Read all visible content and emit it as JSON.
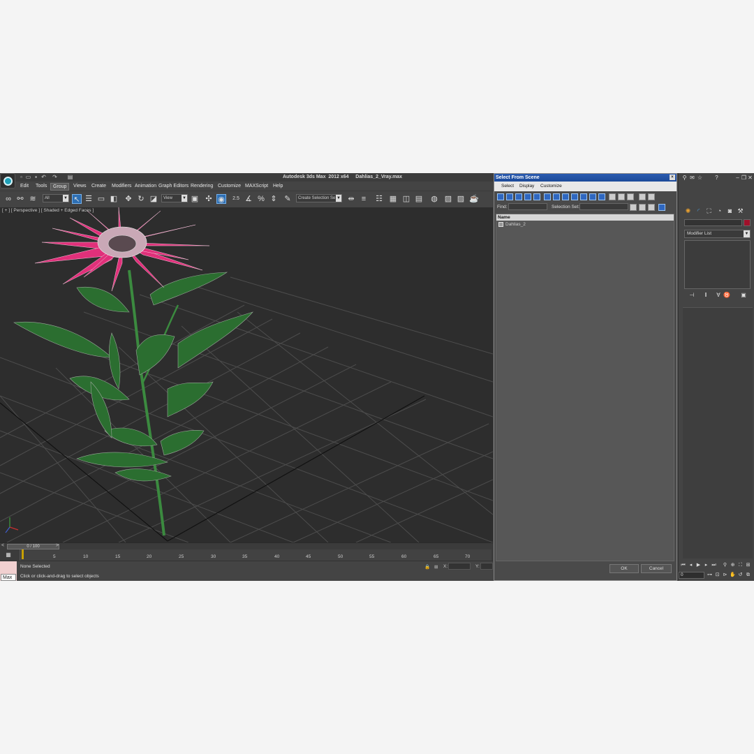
{
  "window": {
    "title": "Autodesk 3ds Max  2012 x64     Dahlias_2_Vray.max"
  },
  "menu": {
    "items": [
      "Edit",
      "Tools",
      "Group",
      "Views",
      "Create",
      "Modifiers",
      "Animation",
      "Graph Editors",
      "Rendering",
      "Customize",
      "MAXScript",
      "Help"
    ],
    "active_index": 2
  },
  "toolbar": {
    "filter_value": "All",
    "refcoord_value": "View",
    "selection_set_placeholder": "Create Selection Se",
    "snap_label": "2.5"
  },
  "viewport": {
    "label": "[ + ] [ Perspective ] [ Shaded + Edged Faces ]"
  },
  "timeline": {
    "frame_readout": "0 / 100",
    "ticks": [
      "5",
      "10",
      "15",
      "20",
      "25",
      "30",
      "35",
      "40",
      "45",
      "50",
      "55",
      "60",
      "65",
      "70"
    ]
  },
  "status": {
    "selection": "None Selected",
    "prompt": "Click or click-and-drag to select objects",
    "x_label": "X:",
    "y_label": "Y:",
    "max_label": "Max"
  },
  "dialog": {
    "title": "Select From Scene",
    "menu": [
      "Select",
      "Display",
      "Customize"
    ],
    "find_label": "Find:",
    "selection_set_label": "Selection Set:",
    "column_name": "Name",
    "objects": [
      "Dahlias_2"
    ],
    "ok_label": "OK",
    "cancel_label": "Cancel",
    "close_glyph": "×"
  },
  "command_panel": {
    "modifier_list": "Modifier List",
    "object_color": "#a0102a",
    "frame_value": "0"
  },
  "colors": {
    "accent": "#2d6fb4",
    "flower_petal": "#e0307a",
    "leaf": "#2e7a34",
    "viewport_bg": "#2d2d2d"
  }
}
